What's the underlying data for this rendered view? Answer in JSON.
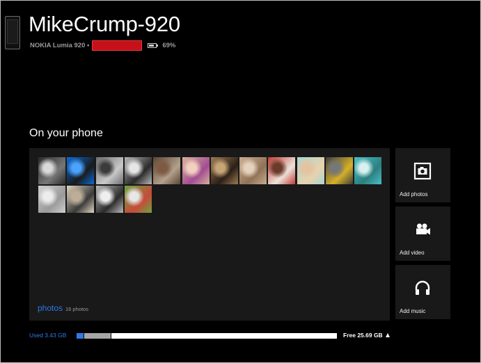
{
  "header": {
    "device_name": "MikeCrump-920",
    "model": "NOKIA Lumia 920 •",
    "battery_percent": "69%",
    "icons": [
      "phone-icon",
      "battery-icon"
    ]
  },
  "section": {
    "heading": "On your phone"
  },
  "photos": {
    "label": "photos",
    "count_label": "16 photos",
    "thumbnails": [
      {
        "name": "photo-01",
        "colors": [
          "#2a2a2a",
          "#777777",
          "#d9d9d9"
        ]
      },
      {
        "name": "photo-02",
        "colors": [
          "#0b6bd8",
          "#1a1a1a",
          "#4aa3ff"
        ]
      },
      {
        "name": "photo-03",
        "colors": [
          "#6e6e6e",
          "#c9c9c9",
          "#3b3b3b"
        ]
      },
      {
        "name": "photo-04",
        "colors": [
          "#b8b8b8",
          "#2a2a2a",
          "#e6e6e6"
        ]
      },
      {
        "name": "photo-05",
        "colors": [
          "#5b4434",
          "#b3a18c",
          "#7d5a43"
        ]
      },
      {
        "name": "photo-06",
        "colors": [
          "#d7b29a",
          "#a24c92",
          "#f2d0c0"
        ]
      },
      {
        "name": "photo-07",
        "colors": [
          "#9c7b52",
          "#2b1f17",
          "#c7a577"
        ]
      },
      {
        "name": "photo-08",
        "colors": [
          "#c9ad8f",
          "#8f7257",
          "#e5d2bd"
        ]
      },
      {
        "name": "photo-09",
        "colors": [
          "#c23b35",
          "#ece3da",
          "#6b3a2a"
        ]
      },
      {
        "name": "photo-10",
        "colors": [
          "#a9d6d1",
          "#e8d2ad",
          "#e4c3a1"
        ]
      },
      {
        "name": "photo-11",
        "colors": [
          "#3d3d3d",
          "#d7b12a",
          "#777777"
        ]
      },
      {
        "name": "photo-12",
        "colors": [
          "#49c0c5",
          "#2c7f7f",
          "#d8f0ee"
        ]
      },
      {
        "name": "photo-13",
        "colors": [
          "#cfcfcf",
          "#9a9a9a",
          "#ececec"
        ]
      },
      {
        "name": "photo-14",
        "colors": [
          "#e1d6c2",
          "#3a3a3a",
          "#bcae98"
        ]
      },
      {
        "name": "photo-15",
        "colors": [
          "#bcbcbc",
          "#2b2b2b",
          "#efefef"
        ]
      },
      {
        "name": "photo-16",
        "colors": [
          "#6da43f",
          "#c64a3a",
          "#e7e7e7"
        ]
      }
    ]
  },
  "tiles": [
    {
      "label": "Add photos",
      "icon": "camera-frame-icon"
    },
    {
      "label": "Add video",
      "icon": "video-camera-icon"
    },
    {
      "label": "Add music",
      "icon": "headphones-icon"
    }
  ],
  "storage": {
    "used_label": "Used 3.43 GB",
    "free_label": "Free 25.69 GB",
    "used_color": "#2f78e8",
    "other_color": "#a6a6a6",
    "free_color": "#ffffff"
  },
  "colors": {
    "background": "#000000",
    "panel": "#191919",
    "accent": "#2f78e8",
    "redaction": "#c8101a"
  }
}
